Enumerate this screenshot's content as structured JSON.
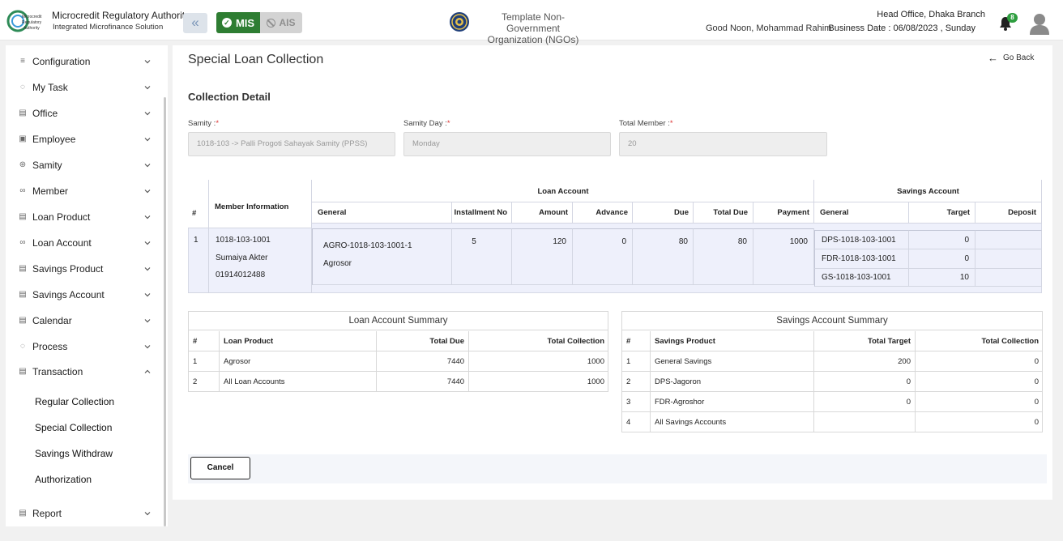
{
  "header": {
    "brand_title": "Microcredit Regulatory Authority",
    "brand_subtitle": "Integrated Microfinance Solution",
    "logo_text": [
      "Microcredit",
      "Regulatory",
      "Authority"
    ],
    "mis_label": "MIS",
    "ais_label": "AIS",
    "org_name_line1": "Template Non-Government",
    "org_name_line2": "Organization (NGOs)",
    "greeting": "Good Noon, Mohammad Rahim",
    "branch": "Head Office, Dhaka Branch",
    "business_date": "Business Date : 06/08/2023 , Sunday",
    "notification_count": "8",
    "accent_green": "#2e7d32"
  },
  "sidebar": {
    "items": [
      {
        "label": "Configuration",
        "icon": "sliders-icon",
        "expanded": false
      },
      {
        "label": "My Task",
        "icon": "spinner-icon",
        "expanded": false
      },
      {
        "label": "Office",
        "icon": "document-icon",
        "expanded": false
      },
      {
        "label": "Employee",
        "icon": "id-card-icon",
        "expanded": false
      },
      {
        "label": "Samity",
        "icon": "group-icon",
        "expanded": false
      },
      {
        "label": "Member",
        "icon": "users-icon",
        "expanded": false
      },
      {
        "label": "Loan Product",
        "icon": "document-icon",
        "expanded": false
      },
      {
        "label": "Loan Account",
        "icon": "users-icon",
        "expanded": false
      },
      {
        "label": "Savings Product",
        "icon": "document-icon",
        "expanded": false
      },
      {
        "label": "Savings Account",
        "icon": "document-icon",
        "expanded": false
      },
      {
        "label": "Calendar",
        "icon": "document-icon",
        "expanded": false
      },
      {
        "label": "Process",
        "icon": "spinner-icon",
        "expanded": false
      },
      {
        "label": "Transaction",
        "icon": "document-icon",
        "expanded": true
      },
      {
        "label": "Report",
        "icon": "document-icon",
        "expanded": false
      }
    ],
    "transaction_sub": [
      "Regular Collection",
      "Special Collection",
      "Savings Withdraw",
      "Authorization"
    ]
  },
  "page": {
    "title": "Special Loan Collection",
    "go_back": "Go Back",
    "section_title": "Collection Detail",
    "fields": {
      "samity_label": "Samity :",
      "samity_value": "1018-103 -> Palli Progoti Sahayak Samity (PPSS)",
      "day_label": "Samity Day :",
      "day_value": "Monday",
      "total_member_label": "Total Member :",
      "total_member_value": "20",
      "required_mark": "*"
    },
    "cancel_label": "Cancel"
  },
  "collection": {
    "headers": {
      "index": "#",
      "member_info": "Member Information",
      "loan_account": "Loan Account",
      "savings_account": "Savings Account",
      "loan_cols": [
        "General",
        "Installment No",
        "Amount",
        "Advance",
        "Due",
        "Total Due",
        "Payment"
      ],
      "savings_cols": [
        "General",
        "Target",
        "Deposit"
      ]
    },
    "row": {
      "index": "1",
      "member_code": "1018-103-1001",
      "member_name": "Sumaiya Akter",
      "member_phone": "01914012488",
      "loan_account": "AGRO-1018-103-1001-1",
      "loan_product": "Agrosor",
      "installment_no": "5",
      "amount": "120",
      "advance": "0",
      "due": "80",
      "total_due": "80",
      "payment": "1000",
      "savings": [
        {
          "account": "DPS-1018-103-1001",
          "target": "0",
          "deposit": ""
        },
        {
          "account": "FDR-1018-103-1001",
          "target": "0",
          "deposit": ""
        },
        {
          "account": "GS-1018-103-1001",
          "target": "10",
          "deposit": ""
        }
      ]
    }
  },
  "loan_summary": {
    "title": "Loan Account Summary",
    "headers": [
      "#",
      "Loan Product",
      "Total Due",
      "Total Collection"
    ],
    "rows": [
      [
        "1",
        "Agrosor",
        "7440",
        "1000"
      ],
      [
        "2",
        "All Loan Accounts",
        "7440",
        "1000"
      ]
    ]
  },
  "savings_summary": {
    "title": "Savings Account Summary",
    "headers": [
      "#",
      "Savings Product",
      "Total Target",
      "Total Collection"
    ],
    "rows": [
      [
        "1",
        "General Savings",
        "200",
        "0"
      ],
      [
        "2",
        "DPS-Jagoron",
        "0",
        "0"
      ],
      [
        "3",
        "FDR-Agroshor",
        "0",
        "0"
      ],
      [
        "4",
        "All Savings Accounts",
        "",
        "0"
      ]
    ]
  }
}
